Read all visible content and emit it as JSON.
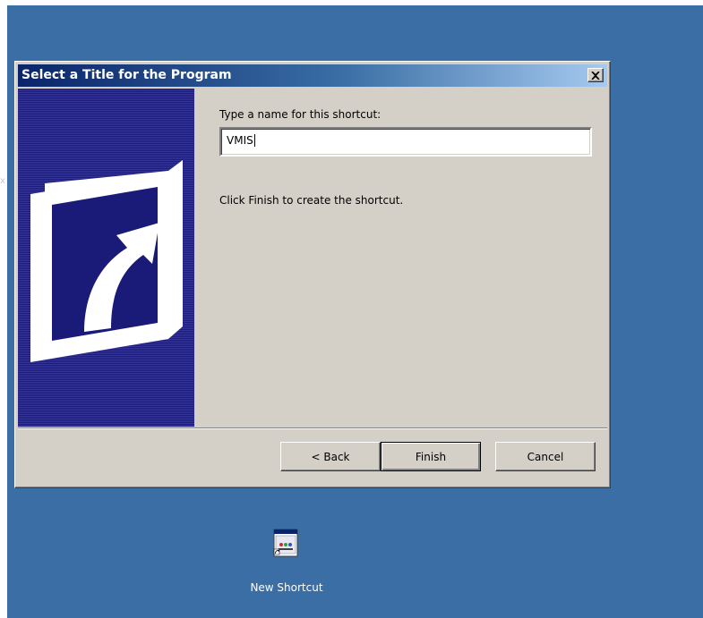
{
  "dialog": {
    "title": "Select a Title for the Program",
    "close_glyph": "×",
    "name_label": "Type a name for this shortcut:",
    "name_value": "VMIS",
    "finish_hint": "Click Finish to create the shortcut.",
    "buttons": {
      "back": "< Back",
      "finish": "Finish",
      "cancel": "Cancel"
    },
    "banner_icon": "shortcut-arrow-icon"
  },
  "desktop": {
    "background_color": "#3a6ea5",
    "stray_text": "x",
    "shortcut": {
      "label": "New Shortcut",
      "icon": "application-window-icon"
    }
  },
  "colors": {
    "titlebar_start": "#0a246a",
    "titlebar_end": "#a6caf0",
    "banner": "#2a2a8c",
    "dialog_face": "#d4d0c8"
  }
}
